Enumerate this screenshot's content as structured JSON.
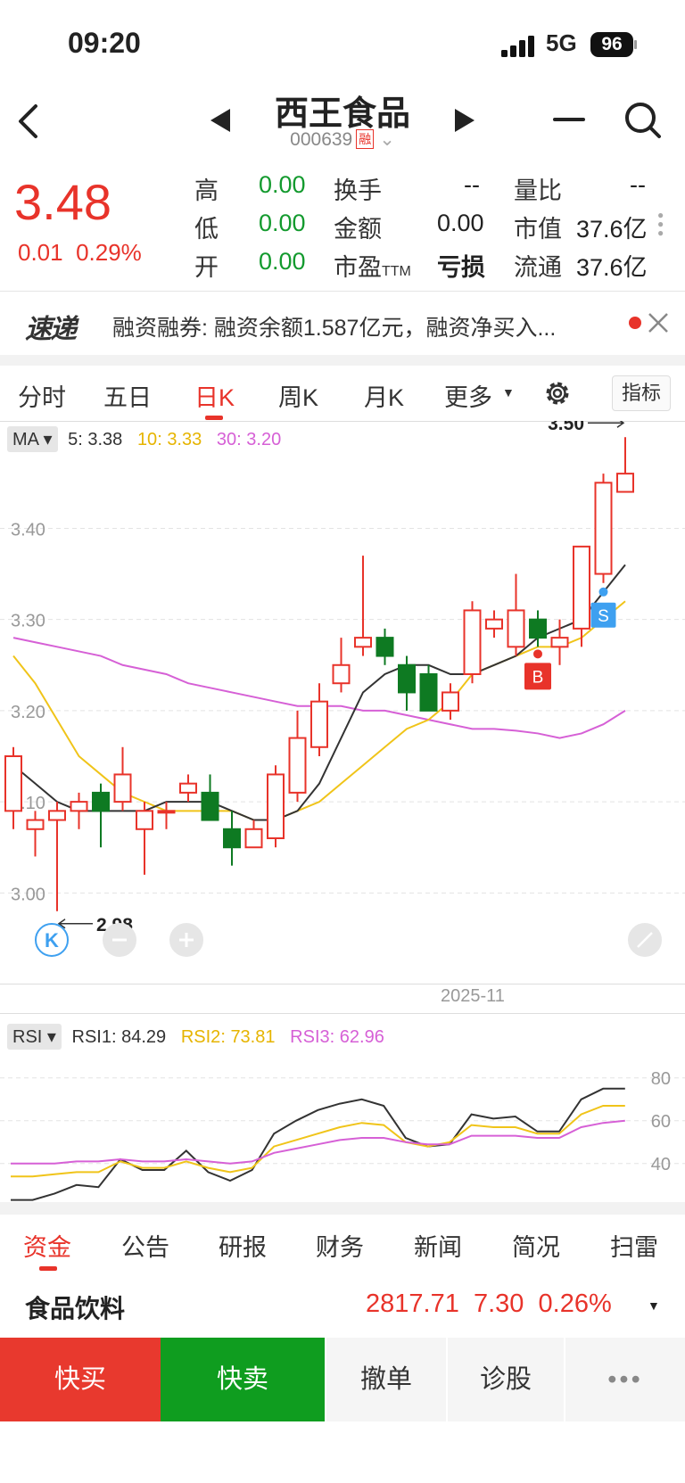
{
  "status_bar": {
    "time": "09:20",
    "network": "5G",
    "battery": "96"
  },
  "nav": {
    "title": "西王食品",
    "code": "000639",
    "badge": "融"
  },
  "quote": {
    "price": "3.48",
    "change": "0.01",
    "change_pct": "0.29%",
    "rows": [
      [
        {
          "label": "高",
          "value": "0.00"
        },
        {
          "label": "换手",
          "value": "--"
        },
        {
          "label": "量比",
          "value": "--"
        }
      ],
      [
        {
          "label": "低",
          "value": "0.00"
        },
        {
          "label": "金额",
          "value": "0.00"
        },
        {
          "label": "市值",
          "value": "37.6亿"
        }
      ],
      [
        {
          "label": "开",
          "value": "0.00"
        },
        {
          "label": "市盈",
          "label_sub": "TTM",
          "value": "亏损"
        },
        {
          "label": "流通",
          "value": "37.6亿"
        }
      ]
    ]
  },
  "ticker": {
    "brand": "速递",
    "text": "融资融券: 融资余额1.587亿元，融资净买入..."
  },
  "chart_tabs": [
    "分时",
    "五日",
    "日K",
    "周K",
    "月K",
    "更多"
  ],
  "active_tab": "日K",
  "indicator_label": "指标",
  "colors": {
    "up": "#e8332a",
    "down": "#0e7a22",
    "ma5": "#333333",
    "ma10": "#f0c419",
    "ma30": "#d660d6"
  },
  "chart_data": [
    {
      "type": "candlestick",
      "indicator": "MA",
      "legend": [
        {
          "name": "5",
          "value": "3.38"
        },
        {
          "name": "10",
          "value": "3.33"
        },
        {
          "name": "30",
          "value": "3.20"
        }
      ],
      "y_ticks": [
        "3.40",
        "3.30",
        "3.20",
        "3.10",
        "3.00"
      ],
      "ylim": [
        2.97,
        3.51
      ],
      "x_label": "2025-11",
      "max_marker": "3.50",
      "min_marker": "2.98",
      "signals": [
        {
          "type": "S",
          "index": 27
        },
        {
          "type": "B",
          "index": 24
        }
      ],
      "candles": [
        {
          "o": 3.09,
          "c": 3.15,
          "h": 3.16,
          "l": 3.07
        },
        {
          "o": 3.07,
          "c": 3.08,
          "h": 3.09,
          "l": 3.04
        },
        {
          "o": 3.08,
          "c": 3.09,
          "h": 3.1,
          "l": 2.98
        },
        {
          "o": 3.09,
          "c": 3.1,
          "h": 3.11,
          "l": 3.07
        },
        {
          "o": 3.11,
          "c": 3.09,
          "h": 3.12,
          "l": 3.05
        },
        {
          "o": 3.1,
          "c": 3.13,
          "h": 3.16,
          "l": 3.09
        },
        {
          "o": 3.07,
          "c": 3.09,
          "h": 3.1,
          "l": 3.02
        },
        {
          "o": 3.09,
          "c": 3.09,
          "h": 3.1,
          "l": 3.07
        },
        {
          "o": 3.11,
          "c": 3.12,
          "h": 3.13,
          "l": 3.1
        },
        {
          "o": 3.11,
          "c": 3.08,
          "h": 3.13,
          "l": 3.08
        },
        {
          "o": 3.07,
          "c": 3.05,
          "h": 3.09,
          "l": 3.03
        },
        {
          "o": 3.05,
          "c": 3.07,
          "h": 3.08,
          "l": 3.05
        },
        {
          "o": 3.06,
          "c": 3.13,
          "h": 3.14,
          "l": 3.05
        },
        {
          "o": 3.11,
          "c": 3.17,
          "h": 3.2,
          "l": 3.1
        },
        {
          "o": 3.16,
          "c": 3.21,
          "h": 3.23,
          "l": 3.15
        },
        {
          "o": 3.23,
          "c": 3.25,
          "h": 3.28,
          "l": 3.22
        },
        {
          "o": 3.27,
          "c": 3.28,
          "h": 3.37,
          "l": 3.26
        },
        {
          "o": 3.28,
          "c": 3.26,
          "h": 3.29,
          "l": 3.25
        },
        {
          "o": 3.25,
          "c": 3.22,
          "h": 3.26,
          "l": 3.2
        },
        {
          "o": 3.24,
          "c": 3.2,
          "h": 3.25,
          "l": 3.2
        },
        {
          "o": 3.2,
          "c": 3.22,
          "h": 3.23,
          "l": 3.19
        },
        {
          "o": 3.24,
          "c": 3.31,
          "h": 3.32,
          "l": 3.23
        },
        {
          "o": 3.29,
          "c": 3.3,
          "h": 3.31,
          "l": 3.28
        },
        {
          "o": 3.27,
          "c": 3.31,
          "h": 3.35,
          "l": 3.26
        },
        {
          "o": 3.3,
          "c": 3.28,
          "h": 3.31,
          "l": 3.27
        },
        {
          "o": 3.27,
          "c": 3.28,
          "h": 3.3,
          "l": 3.25
        },
        {
          "o": 3.29,
          "c": 3.38,
          "h": 3.38,
          "l": 3.27
        },
        {
          "o": 3.35,
          "c": 3.45,
          "h": 3.46,
          "l": 3.34
        },
        {
          "o": 3.44,
          "c": 3.46,
          "h": 3.5,
          "l": 3.44
        }
      ],
      "ma5": [
        3.14,
        3.12,
        3.1,
        3.09,
        3.09,
        3.09,
        3.09,
        3.1,
        3.1,
        3.1,
        3.09,
        3.08,
        3.08,
        3.09,
        3.12,
        3.17,
        3.22,
        3.24,
        3.25,
        3.25,
        3.24,
        3.24,
        3.25,
        3.26,
        3.28,
        3.29,
        3.3,
        3.33,
        3.36
      ],
      "ma10": [
        3.26,
        3.23,
        3.19,
        3.15,
        3.13,
        3.11,
        3.1,
        3.09,
        3.09,
        3.09,
        3.09,
        3.08,
        3.08,
        3.09,
        3.1,
        3.12,
        3.14,
        3.16,
        3.18,
        3.19,
        3.21,
        3.24,
        3.25,
        3.26,
        3.27,
        3.27,
        3.28,
        3.3,
        3.32
      ],
      "ma30": [
        3.28,
        3.275,
        3.27,
        3.265,
        3.26,
        3.25,
        3.245,
        3.24,
        3.23,
        3.225,
        3.22,
        3.215,
        3.21,
        3.205,
        3.205,
        3.205,
        3.2,
        3.2,
        3.195,
        3.19,
        3.185,
        3.18,
        3.18,
        3.178,
        3.175,
        3.17,
        3.175,
        3.185,
        3.2
      ]
    },
    {
      "type": "line",
      "indicator": "RSI",
      "legend": [
        {
          "name": "RSI1",
          "value": "84.29"
        },
        {
          "name": "RSI2",
          "value": "73.81"
        },
        {
          "name": "RSI3",
          "value": "62.96"
        }
      ],
      "y_ticks": [
        "80",
        "60",
        "40"
      ],
      "ylim": [
        22,
        92
      ],
      "series": [
        {
          "name": "RSI1",
          "values": [
            23,
            23,
            26,
            30,
            29,
            42,
            37,
            37,
            46,
            36,
            32,
            37,
            54,
            60,
            65,
            68,
            70,
            67,
            52,
            48,
            49,
            63,
            61,
            62,
            55,
            55,
            70,
            75,
            75
          ]
        },
        {
          "name": "RSI2",
          "values": [
            34,
            34,
            35,
            36,
            36,
            41,
            38,
            38,
            41,
            38,
            36,
            38,
            48,
            51,
            54,
            57,
            59,
            58,
            50,
            48,
            50,
            58,
            57,
            57,
            54,
            54,
            63,
            67,
            67
          ]
        },
        {
          "name": "RSI3",
          "values": [
            40,
            40,
            40,
            41,
            41,
            42,
            41,
            41,
            42,
            41,
            40,
            41,
            45,
            47,
            49,
            51,
            52,
            52,
            50,
            49,
            49,
            53,
            53,
            53,
            52,
            52,
            57,
            59,
            60
          ]
        }
      ]
    }
  ],
  "bottom_tabs": [
    "资金",
    "公告",
    "研报",
    "财务",
    "新闻",
    "简况",
    "扫雷"
  ],
  "active_bottom_tab": "资金",
  "sector": {
    "name": "食品饮料",
    "value": "2817.71",
    "change": "7.30",
    "change_pct": "0.26%"
  },
  "actions": {
    "buy": "快买",
    "sell": "快卖",
    "cancel": "撤单",
    "diagnose": "诊股",
    "more": "•••"
  },
  "chart_controls": {
    "kline_icon": "K",
    "zoom_out_icon": "minus-icon",
    "zoom_in_icon": "plus-icon",
    "expand_icon": "expand-icon"
  }
}
